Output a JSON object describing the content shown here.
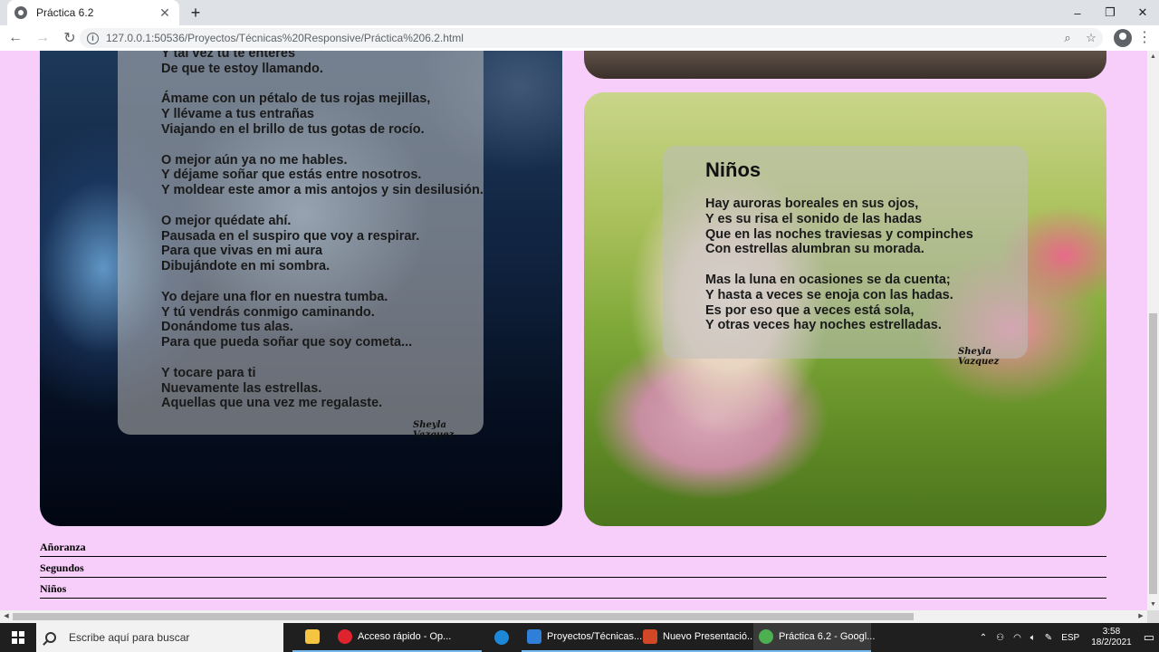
{
  "browser": {
    "tab_title": "Práctica 6.2",
    "tab_close": "✕",
    "new_tab": "+",
    "url": "127.0.0.1:50536/Proyectos/Técnicas%20Responsive/Práctica%206.2.html",
    "window_controls": {
      "minimize": "–",
      "maximize": "❐",
      "close": "✕"
    }
  },
  "left_card": {
    "poem_text": "Y tal vez tú te enteres\nDe que te estoy llamando.\n\nÁmame con un pétalo de tus rojas mejillas,\nY llévame a tus entrañas\nViajando en el brillo de tus gotas de rocío.\n\nO mejor aún ya no me hables.\nY déjame soñar que estás entre nosotros.\nY moldear este amor a mis antojos y sin desilusión.\n\nO mejor quédate ahí.\nPausada en el suspiro que voy a respirar.\nPara que vivas en mi aura\nDibujándote en mi sombra.\n\nYo dejare una flor en nuestra tumba.\nY tú vendrás conmigo caminando.\nDonándome tus alas.\nPara que pueda soñar que soy cometa...\n\nY tocare para ti\nNuevamente las estrellas.\nAquellas que una vez me regalaste.",
    "signature": "Sheyla Vazquez"
  },
  "right_card": {
    "title": "Niños",
    "poem_text": "Hay auroras boreales en sus ojos,\nY es su risa el sonido de las hadas\nQue en las noches traviesas y compinches\nCon estrellas alumbran su morada.\n\nMas la luna en ocasiones se da cuenta;\nY hasta a veces se enoja con las hadas.\nEs por eso que a veces está sola,\nY otras veces hay noches estrelladas.",
    "signature": "Sheyla Vazquez"
  },
  "links": [
    "Añoranza",
    "Segundos",
    "Niños"
  ],
  "taskbar": {
    "search_placeholder": "Escribe aquí para buscar",
    "apps": [
      {
        "label": "",
        "icon": "file-explorer-icon",
        "color": "#f5c542"
      },
      {
        "label": "Acceso rápido - Op...",
        "icon": "opera-icon",
        "color": "#e0242f"
      },
      {
        "label": "",
        "icon": "edge-icon",
        "color": "#1e88d8"
      },
      {
        "label": "Proyectos/Técnicas...",
        "icon": "editor-icon",
        "color": "#2f7fd8"
      },
      {
        "label": "Nuevo Presentació...",
        "icon": "powerpoint-icon",
        "color": "#d24726"
      },
      {
        "label": "Práctica 6.2 - Googl...",
        "icon": "chrome-icon",
        "color": "#4caf50"
      }
    ],
    "tray": {
      "language": "ESP",
      "time": "3:58",
      "date": "18/2/2021"
    }
  }
}
